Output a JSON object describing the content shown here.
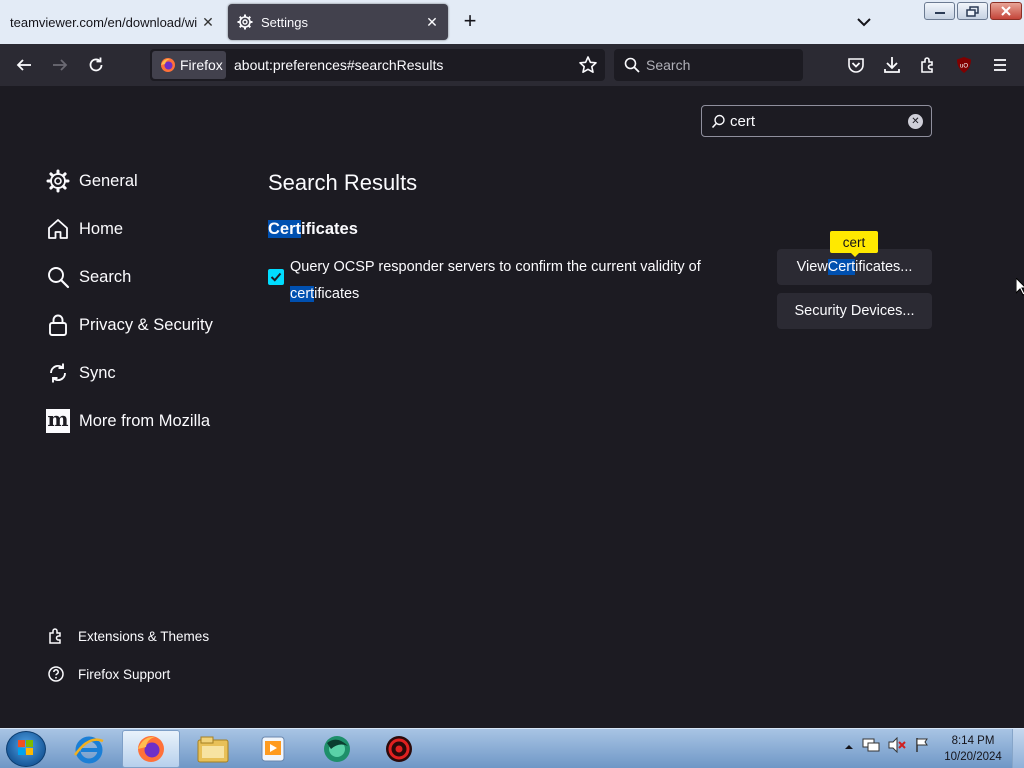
{
  "tabs": [
    {
      "title": "teamviewer.com/en/download/win",
      "active": false
    },
    {
      "title": "Settings",
      "active": true
    }
  ],
  "navbar": {
    "identity_label": "Firefox",
    "url": "about:preferences#searchResults",
    "search_placeholder": "Search"
  },
  "prefs_search": {
    "value": "cert"
  },
  "categories": [
    {
      "label": "General",
      "icon": "gear-icon"
    },
    {
      "label": "Home",
      "icon": "home-icon"
    },
    {
      "label": "Search",
      "icon": "search-icon"
    },
    {
      "label": "Privacy & Security",
      "icon": "lock-icon"
    },
    {
      "label": "Sync",
      "icon": "sync-icon"
    },
    {
      "label": "More from Mozilla",
      "icon": "mozilla-icon"
    }
  ],
  "footer": {
    "extensions": "Extensions & Themes",
    "support": "Firefox Support"
  },
  "results": {
    "title": "Search Results",
    "section": {
      "highlight": "Cert",
      "rest": "ificates"
    },
    "ocsp": {
      "checked": true,
      "before": "Query OCSP responder servers to confirm the current validity of ",
      "highlight": "cert",
      "after": "ificates"
    },
    "view_certs": {
      "before": "View ",
      "highlight": "Cert",
      "after": "ificates..."
    },
    "security_devices": "Security Devices...",
    "tooltip": "cert"
  },
  "taskbar": {
    "time": "8:14 PM",
    "date": "10/20/2024",
    "apps": [
      "internet-explorer-icon",
      "firefox-icon",
      "file-explorer-icon",
      "media-player-icon",
      "browser-icon",
      "app-icon"
    ]
  },
  "colors": {
    "page_bg": "#1c1b22",
    "highlight": "#0050b0",
    "checkbox": "#00ddff",
    "tooltip": "#ffe900"
  }
}
